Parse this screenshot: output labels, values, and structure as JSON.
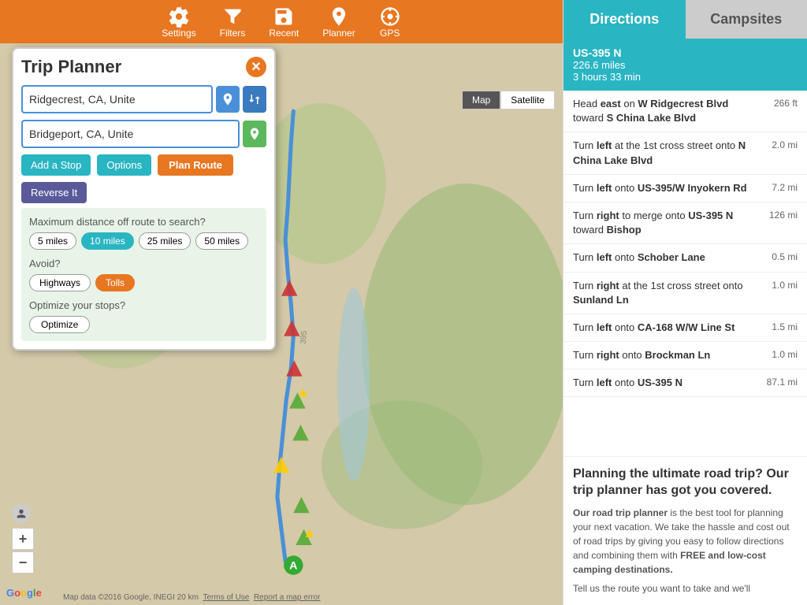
{
  "app": {
    "title": "Trip Planner"
  },
  "toolbar": {
    "items": [
      {
        "label": "Settings",
        "icon": "gear"
      },
      {
        "label": "Filters",
        "icon": "filter"
      },
      {
        "label": "Recent",
        "icon": "save"
      },
      {
        "label": "Planner",
        "icon": "map-pin"
      },
      {
        "label": "GPS",
        "icon": "gps"
      }
    ]
  },
  "trip_planner": {
    "title": "Trip Planner",
    "close_label": "✕",
    "from_value": "Ridgecrest, CA, Unite",
    "to_value": "Bridgeport, CA, Unite",
    "add_stop_label": "Add a Stop",
    "options_label": "Options",
    "plan_route_label": "Plan Route",
    "reverse_label": "Reverse It",
    "max_distance_label": "Maximum distance off route to search?",
    "distances": [
      "5 miles",
      "10 miles",
      "25 miles",
      "50 miles"
    ],
    "active_distance": "10 miles",
    "avoid_label": "Avoid?",
    "avoid_options": [
      "Highways",
      "Tolls"
    ],
    "optimize_label": "Optimize your stops?",
    "optimize_btn_label": "Optimize"
  },
  "map": {
    "map_label": "Map",
    "satellite_label": "Satellite",
    "zoom_in": "+",
    "zoom_out": "−",
    "attribution": "Map data ©2016 Google, INEGI    20 km",
    "terms": "Terms of Use",
    "report": "Report a map error"
  },
  "tabs": [
    {
      "label": "Directions",
      "active": true
    },
    {
      "label": "Campsites",
      "active": false
    }
  ],
  "route_summary": {
    "name": "US-395 N",
    "distance": "226.6 miles",
    "time": "3 hours 33 min"
  },
  "directions": [
    {
      "text": "Head east on W Ridgecrest Blvd toward S China Lake Blvd",
      "dist": "266 ft",
      "bold_word": "east"
    },
    {
      "text": "Turn left at the 1st cross street onto N China Lake Blvd",
      "dist": "2.0 mi",
      "bold_word": "left"
    },
    {
      "text": "Turn left onto US-395/W Inyokern Rd",
      "dist": "7.2 mi",
      "bold_word": "left",
      "bold_extra": "US-395/W Inyokern Rd"
    },
    {
      "text": "Turn right to merge onto US-395 N toward Bishop",
      "dist": "126 mi",
      "bold_word": "right",
      "bold_extra": "US-395 N"
    },
    {
      "text": "Turn left onto Schober Lane",
      "dist": "0.5 mi",
      "bold_word": "left",
      "bold_extra": "Schober Lane"
    },
    {
      "text": "Turn right at the 1st cross street onto Sunland Ln",
      "dist": "1.0 mi",
      "bold_word": "right",
      "bold_extra": "Sunland Ln"
    },
    {
      "text": "Turn left onto CA-168 W/W Line St",
      "dist": "1.5 mi",
      "bold_word": "left",
      "bold_extra": "CA-168 W/W Line St"
    },
    {
      "text": "Turn right onto Brockman Ln",
      "dist": "1.0 mi",
      "bold_word": "right",
      "bold_extra": "Brockman Ln"
    },
    {
      "text": "Turn left onto US-395 N",
      "dist": "87.1 mi",
      "bold_word": "left",
      "bold_extra": "US-395 N"
    }
  ],
  "promo": {
    "title": "Planning the ultimate road trip? Our trip planner has got you covered.",
    "body_bold": "Our road trip planner",
    "body": " is the best tool for planning your next vacation. We take the hassle and cost out of road trips by giving you easy to follow directions and combining them with ",
    "free_bold": "FREE and low-cost camping destinations.",
    "tell": "Tell us the route you want to take and we'll"
  }
}
